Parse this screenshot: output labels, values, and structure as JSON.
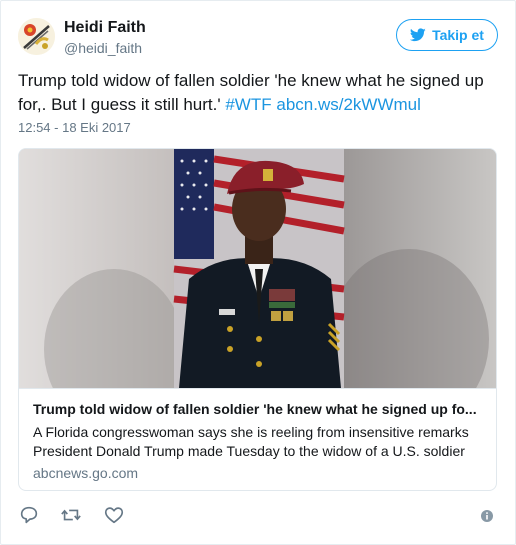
{
  "user": {
    "name": "Heidi Faith",
    "handle": "@heidi_faith"
  },
  "follow_button": {
    "label": "Takip et",
    "icon": "twitter-bird-icon"
  },
  "tweet": {
    "text_plain": "Trump told widow of fallen soldier 'he knew what he signed up for,. But I guess it still hurt.' ",
    "hashtag": "#WTF",
    "link": "abcn.ws/2kWWmul",
    "timestamp": "12:54 - 18 Eki 2017"
  },
  "card": {
    "title": "Trump told widow of fallen soldier 'he knew what he signed up fo...",
    "description": "A Florida congresswoman says she is reeling from insensitive remarks President Donald Trump made Tuesday to the widow of a U.S. soldier",
    "domain": "abcnews.go.com"
  },
  "actions": {
    "reply_icon": "reply-icon",
    "retweet_icon": "retweet-icon",
    "like_icon": "heart-icon",
    "info_icon": "info-icon"
  },
  "colors": {
    "accent": "#1da1f2",
    "link": "#1b95e0",
    "muted": "#657786",
    "border": "#e1e8ed"
  }
}
